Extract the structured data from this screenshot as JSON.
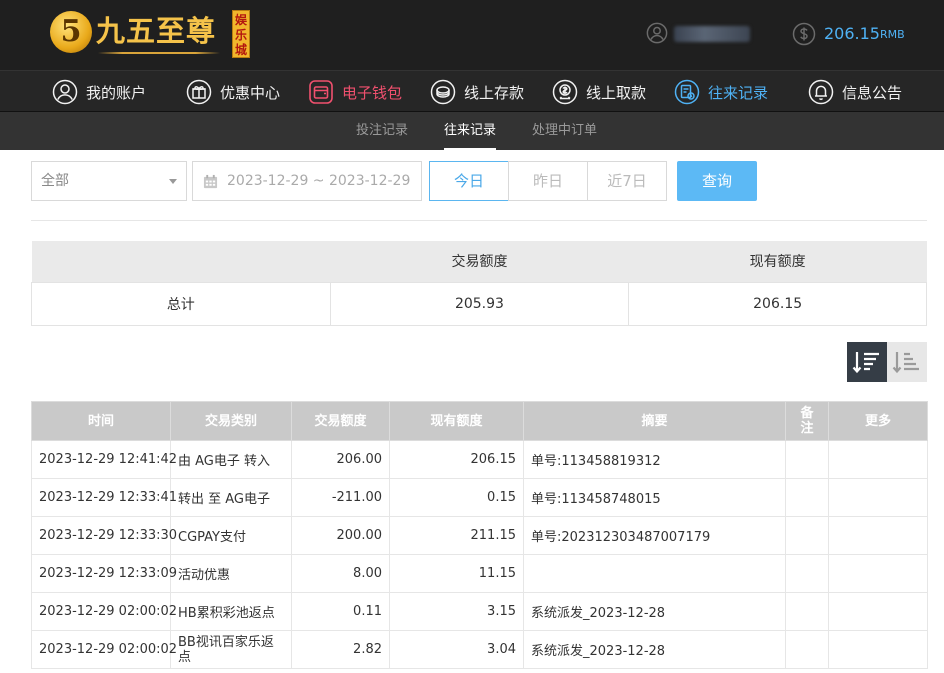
{
  "brand": {
    "logo_char": "5",
    "name": "九五至尊",
    "sub": "娱乐城"
  },
  "user": {
    "balance": "206.15",
    "currency": "RMB"
  },
  "nav": [
    {
      "label": "我的账户",
      "icon": "user-circle-icon"
    },
    {
      "label": "优惠中心",
      "icon": "gift-icon"
    },
    {
      "label": "电子钱包",
      "icon": "wallet-icon"
    },
    {
      "label": "线上存款",
      "icon": "deposit-icon"
    },
    {
      "label": "线上取款",
      "icon": "withdraw-icon"
    },
    {
      "label": "往来记录",
      "icon": "records-icon"
    },
    {
      "label": "信息公告",
      "icon": "bell-icon"
    }
  ],
  "colors": {
    "accent": "#4fb2f5",
    "wallet": "#f0506e",
    "query_button": "#5cb9f5"
  },
  "subnav": [
    "投注记录",
    "往来记录",
    "处理中订单"
  ],
  "filters": {
    "type_selected": "全部",
    "date_range": "2023-12-29 ~ 2023-12-29",
    "quick": [
      "今日",
      "昨日",
      "近7日"
    ],
    "query_label": "查询"
  },
  "summary": {
    "headers": [
      "",
      "交易额度",
      "现有额度"
    ],
    "row": [
      "总计",
      "205.93",
      "206.15"
    ]
  },
  "records": {
    "headers": [
      "时间",
      "交易类别",
      "交易额度",
      "现有额度",
      "摘要",
      "备注",
      "更多"
    ],
    "rows": [
      [
        "2023-12-29 12:41:42",
        "由 AG电子 转入",
        "206.00",
        "206.15",
        "单号:113458819312",
        "",
        ""
      ],
      [
        "2023-12-29 12:33:41",
        "转出 至 AG电子",
        "-211.00",
        "0.15",
        "单号:113458748015",
        "",
        ""
      ],
      [
        "2023-12-29 12:33:30",
        "CGPAY支付",
        "200.00",
        "211.15",
        "单号:202312303487007179",
        "",
        ""
      ],
      [
        "2023-12-29 12:33:09",
        "活动优惠",
        "8.00",
        "11.15",
        "",
        "",
        ""
      ],
      [
        "2023-12-29 02:00:02",
        "HB累积彩池返点",
        "0.11",
        "3.15",
        "系统派发_2023-12-28",
        "",
        ""
      ],
      [
        "2023-12-29 02:00:02",
        "BB视讯百家乐返点",
        "2.82",
        "3.04",
        "系统派发_2023-12-28",
        "",
        ""
      ]
    ]
  }
}
